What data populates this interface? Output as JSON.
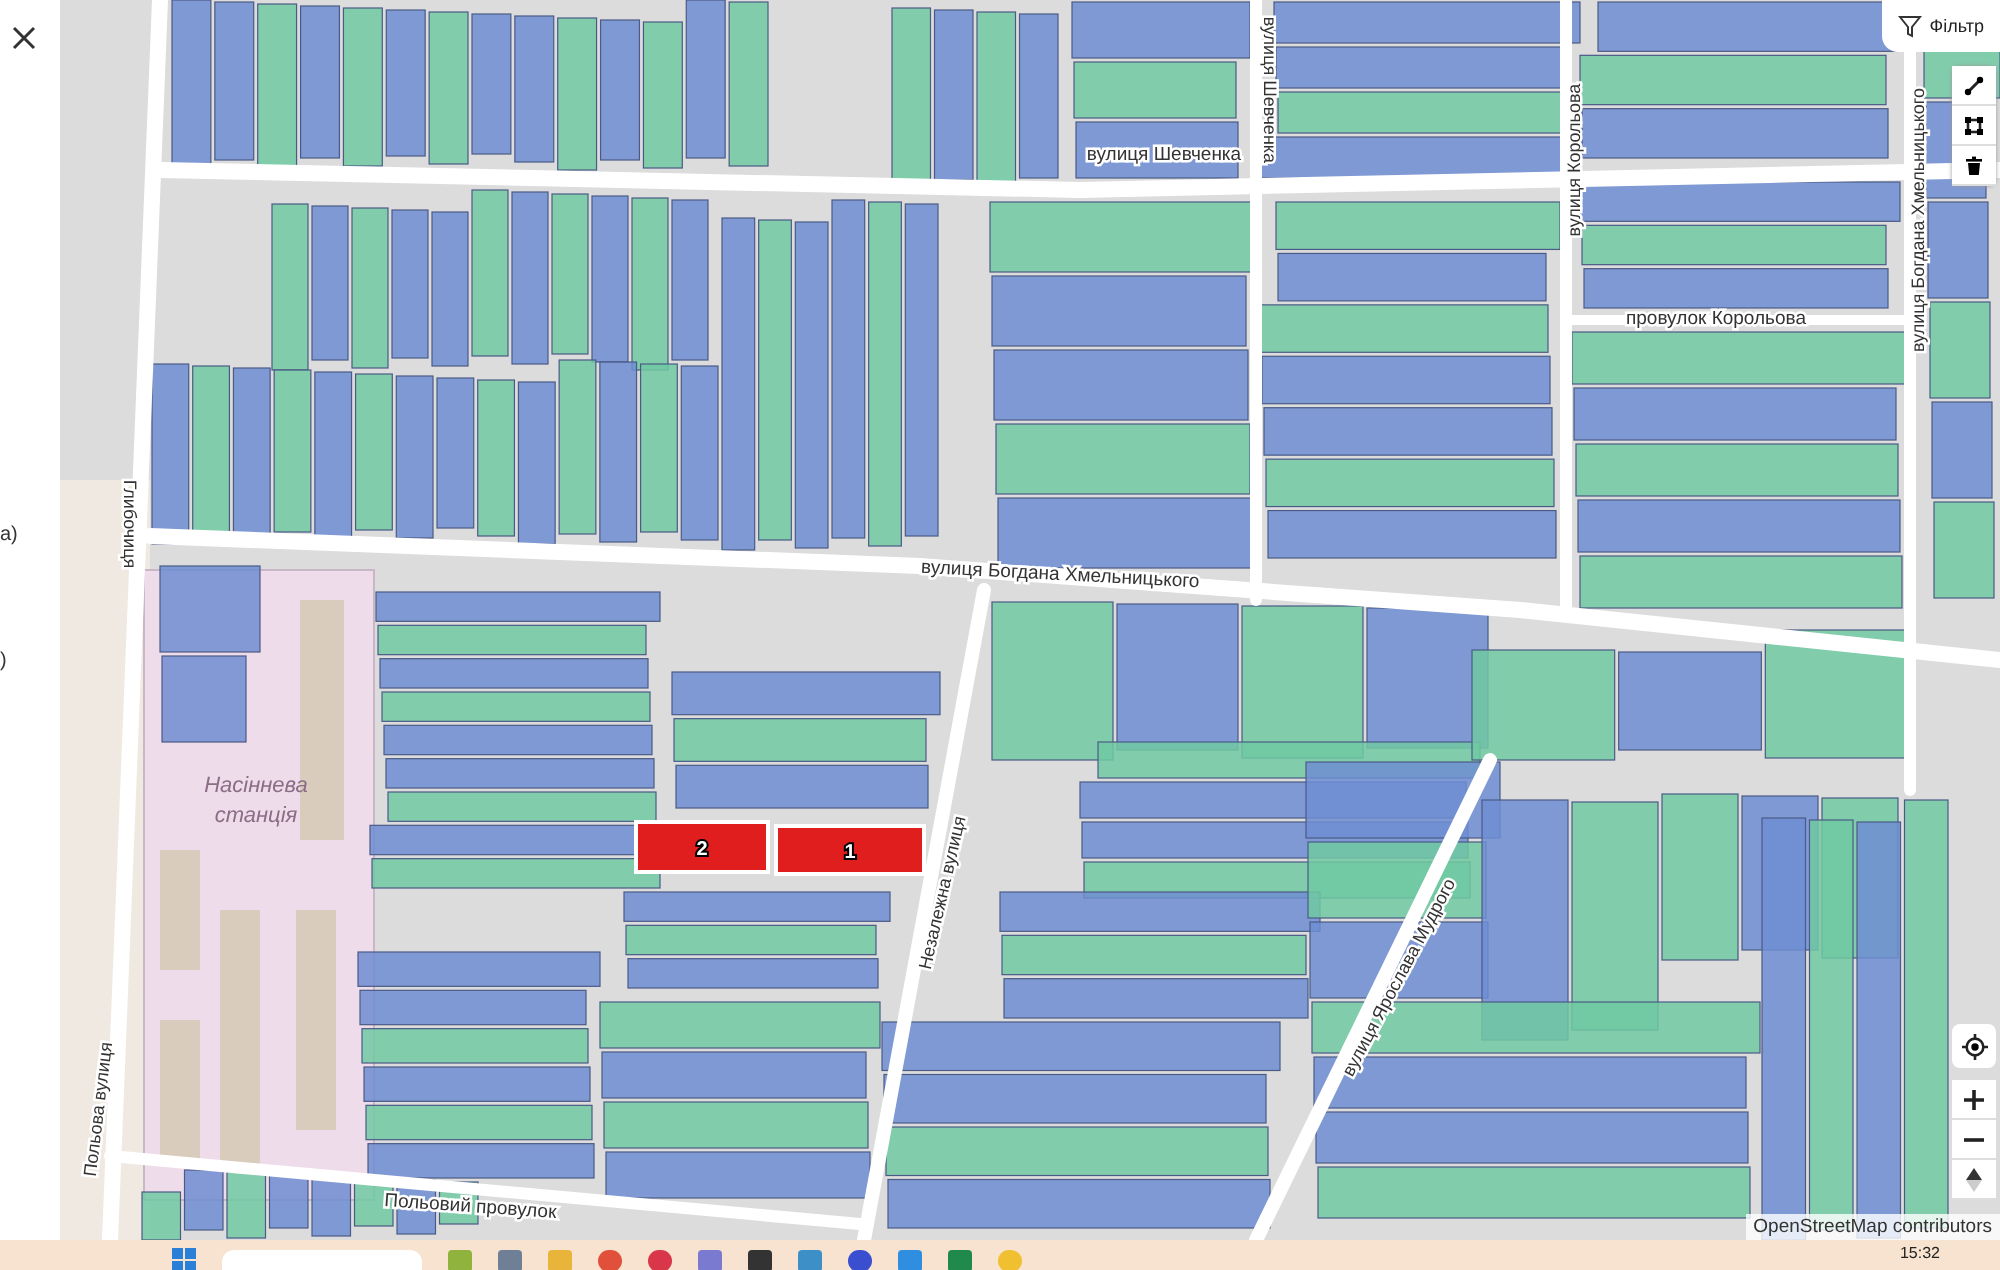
{
  "side_panel": {
    "fragments": [
      "а)",
      ")"
    ]
  },
  "map": {
    "streets": [
      {
        "kind": "h",
        "label": "вулиця Шевченка"
      },
      {
        "kind": "v",
        "label": "вулиця Шевченка"
      },
      {
        "kind": "v",
        "label": "вулиця Корольова"
      },
      {
        "kind": "v",
        "label": "вулиця Богдана Хмельницького"
      },
      {
        "kind": "h",
        "label": "провулок Корольова"
      },
      {
        "kind": "v",
        "label": "Глибочиця"
      },
      {
        "kind": "h",
        "label": "вулиця Богдана Хмельницького"
      },
      {
        "kind": "v",
        "label": "Незалежна вулиця"
      },
      {
        "kind": "v",
        "label": "вулиця Ярослава Мудрого"
      },
      {
        "kind": "v",
        "label": "Польова вулиця"
      },
      {
        "kind": "h",
        "label": "Польовий провулок"
      }
    ],
    "place_label": "Насіннева станція",
    "parcels": [
      {
        "label": "2",
        "selected": true
      },
      {
        "label": "1",
        "selected": true
      }
    ],
    "attribution": "OpenStreetMap contributors"
  },
  "filter_button": {
    "label": "Фільтр"
  },
  "taskbar": {
    "time": "15:32"
  }
}
